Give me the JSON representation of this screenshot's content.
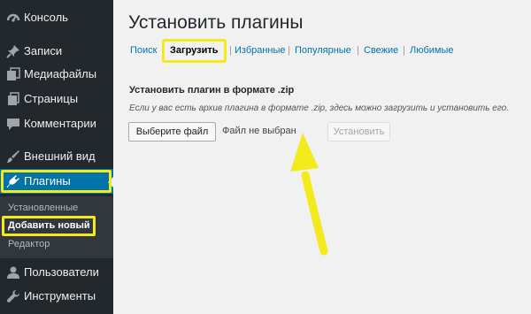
{
  "sidebar": {
    "items": [
      {
        "label": "Консоль",
        "icon": "dashboard-icon"
      },
      {
        "label": "Записи",
        "icon": "pin-icon"
      },
      {
        "label": "Медиафайлы",
        "icon": "media-icon"
      },
      {
        "label": "Страницы",
        "icon": "page-icon"
      },
      {
        "label": "Комментарии",
        "icon": "comment-icon"
      },
      {
        "label": "Внешний вид",
        "icon": "brush-icon"
      },
      {
        "label": "Плагины",
        "icon": "plugin-icon"
      },
      {
        "label": "Пользователи",
        "icon": "users-icon"
      },
      {
        "label": "Инструменты",
        "icon": "wrench-icon"
      }
    ],
    "submenu": [
      "Установленные",
      "Добавить новый",
      "Редактор"
    ]
  },
  "main": {
    "title": "Установить плагины",
    "tabs": [
      "Поиск",
      "Загрузить",
      "Избранные",
      "Популярные",
      "Свежие",
      "Любимые"
    ],
    "tab_separator": "|",
    "upload_heading": "Установить плагин в формате .zip",
    "upload_description": "Если у вас есть архив плагина в формате .zip, здесь можно загрузить и установить его.",
    "file_button": "Выберите файл",
    "file_status": "Файл не выбран",
    "install_button": "Установить"
  },
  "colors": {
    "sidebar_bg": "#23282d",
    "submenu_bg": "#32373c",
    "current_bg": "#0073aa",
    "link": "#0073aa",
    "highlight": "#f3ea1b",
    "page_bg": "#f1f1f1"
  }
}
